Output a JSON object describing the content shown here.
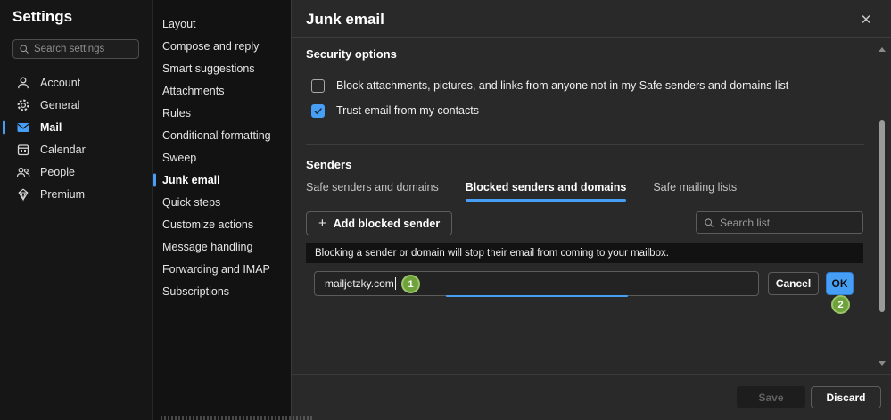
{
  "colors": {
    "accent": "#479ef5",
    "annotation_green": "#6ea33c"
  },
  "sidebar": {
    "title": "Settings",
    "search_placeholder": "Search settings",
    "items": [
      {
        "label": "Account",
        "icon": "person",
        "selected": false
      },
      {
        "label": "General",
        "icon": "gear",
        "selected": false
      },
      {
        "label": "Mail",
        "icon": "mail",
        "selected": true
      },
      {
        "label": "Calendar",
        "icon": "calendar",
        "selected": false
      },
      {
        "label": "People",
        "icon": "people",
        "selected": false
      },
      {
        "label": "Premium",
        "icon": "diamond",
        "selected": false
      }
    ]
  },
  "nav": {
    "items": [
      {
        "label": "Layout",
        "selected": false
      },
      {
        "label": "Compose and reply",
        "selected": false
      },
      {
        "label": "Smart suggestions",
        "selected": false
      },
      {
        "label": "Attachments",
        "selected": false
      },
      {
        "label": "Rules",
        "selected": false
      },
      {
        "label": "Conditional formatting",
        "selected": false
      },
      {
        "label": "Sweep",
        "selected": false
      },
      {
        "label": "Junk email",
        "selected": true
      },
      {
        "label": "Quick steps",
        "selected": false
      },
      {
        "label": "Customize actions",
        "selected": false
      },
      {
        "label": "Message handling",
        "selected": false
      },
      {
        "label": "Forwarding and IMAP",
        "selected": false
      },
      {
        "label": "Subscriptions",
        "selected": false
      }
    ]
  },
  "panel": {
    "title": "Junk email",
    "close_label": "✕",
    "security": {
      "heading": "Security options",
      "checkboxes": [
        {
          "label": "Block attachments, pictures, and links from anyone not in my Safe senders and domains list",
          "checked": false
        },
        {
          "label": "Trust email from my contacts",
          "checked": true
        }
      ]
    },
    "senders": {
      "heading": "Senders",
      "tabs": [
        {
          "label": "Safe senders and domains",
          "active": false
        },
        {
          "label": "Blocked senders and domains",
          "active": true
        },
        {
          "label": "Safe mailing lists",
          "active": false
        }
      ],
      "add_button_label": "Add blocked sender",
      "add_button_plus": "+",
      "search_placeholder": "Search list",
      "info_text": "Blocking a sender or domain will stop their email from coming to your mailbox.",
      "input_value": "mailjetzky.com",
      "cancel_label": "Cancel",
      "ok_label": "OK"
    },
    "footer": {
      "save_label": "Save",
      "discard_label": "Discard"
    }
  },
  "annotations": {
    "step1": "1",
    "step2": "2"
  }
}
